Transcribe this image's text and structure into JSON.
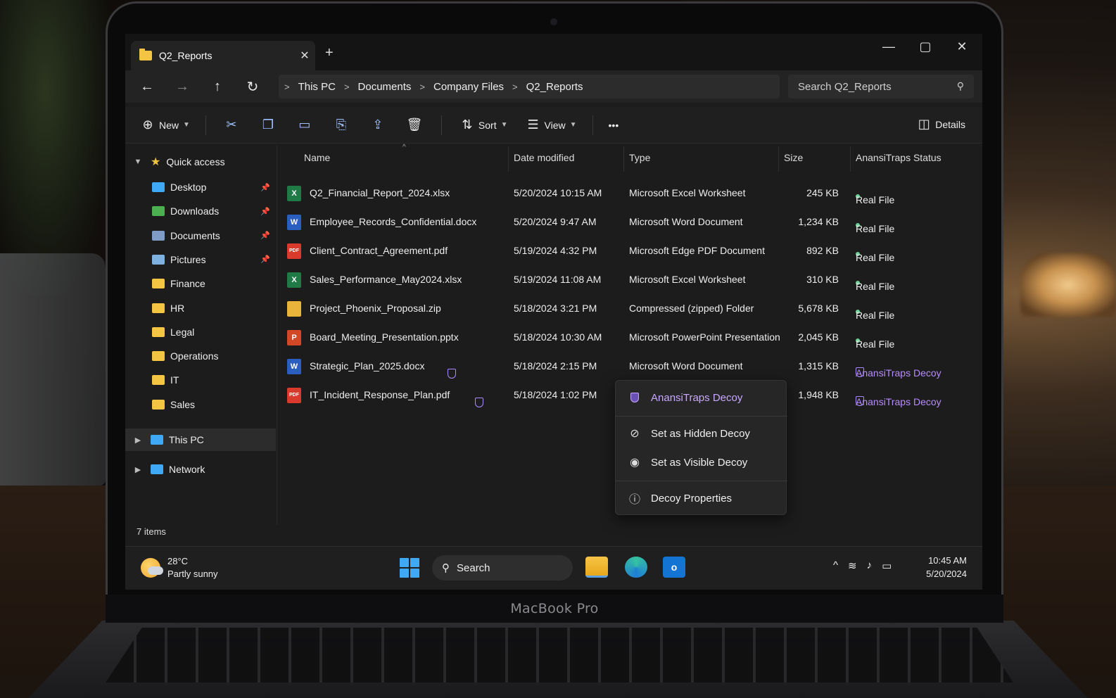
{
  "window": {
    "tab_title": "Q2_Reports",
    "tab_close": "✕",
    "new_tab": "+",
    "minimize": "—",
    "maximize": "▢",
    "close": "✕"
  },
  "nav": {
    "back": "←",
    "forward": "→",
    "up": "↑",
    "refresh": "↻",
    "breadcrumb": [
      "This PC",
      "Documents",
      "Company Files",
      "Q2_Reports"
    ],
    "search_placeholder": "Search Q2_Reports"
  },
  "toolbar": {
    "new_label": "New",
    "sort_label": "Sort",
    "view_label": "View",
    "more_label": "•••",
    "details_label": "Details"
  },
  "sidebar": {
    "quick_access": "Quick access",
    "items": [
      {
        "label": "Desktop",
        "pinned": true
      },
      {
        "label": "Downloads",
        "pinned": true
      },
      {
        "label": "Documents",
        "pinned": true
      },
      {
        "label": "Pictures",
        "pinned": true
      },
      {
        "label": "Finance",
        "pinned": false
      },
      {
        "label": "HR",
        "pinned": false
      },
      {
        "label": "Legal",
        "pinned": false
      },
      {
        "label": "Operations",
        "pinned": false
      },
      {
        "label": "IT",
        "pinned": false
      },
      {
        "label": "Sales",
        "pinned": false
      }
    ],
    "this_pc": "This PC",
    "network": "Network"
  },
  "columns": {
    "name": "Name",
    "date": "Date modified",
    "type": "Type",
    "size": "Size",
    "status": "AnansiTraps Status"
  },
  "files": [
    {
      "name": "Q2_Financial_Report_2024.xlsx",
      "date": "5/20/2024 10:15 AM",
      "type": "Microsoft Excel Worksheet",
      "size": "245 KB",
      "status": "Real File",
      "icon": "excel-icon",
      "decoy": false
    },
    {
      "name": "Employee_Records_Confidential.docx",
      "date": "5/20/2024 9:47 AM",
      "type": "Microsoft Word Document",
      "size": "1,234 KB",
      "status": "Real File",
      "icon": "word-icon",
      "decoy": false
    },
    {
      "name": "Client_Contract_Agreement.pdf",
      "date": "5/19/2024 4:32 PM",
      "type": "Microsoft Edge PDF Document",
      "size": "892 KB",
      "status": "Real File",
      "icon": "pdf-icon",
      "decoy": false
    },
    {
      "name": "Sales_Performance_May2024.xlsx",
      "date": "5/19/2024 11:08 AM",
      "type": "Microsoft Excel Worksheet",
      "size": "310 KB",
      "status": "Real File",
      "icon": "excel-icon",
      "decoy": false
    },
    {
      "name": "Project_Phoenix_Proposal.zip",
      "date": "5/18/2024 3:21 PM",
      "type": "Compressed (zipped) Folder",
      "size": "5,678 KB",
      "status": "Real File",
      "icon": "zip-icon",
      "decoy": false
    },
    {
      "name": "Board_Meeting_Presentation.pptx",
      "date": "5/18/2024 10:30 AM",
      "type": "Microsoft PowerPoint Presentation",
      "size": "2,045 KB",
      "status": "Real File",
      "icon": "powerpoint-icon",
      "decoy": false
    },
    {
      "name": "Strategic_Plan_2025.docx",
      "date": "5/18/2024 2:15 PM",
      "type": "Microsoft Word Document",
      "size": "1,315 KB",
      "status": "AnansiTraps Decoy",
      "icon": "word-icon",
      "decoy": true
    },
    {
      "name": "IT_Incident_Response_Plan.pdf",
      "date": "5/18/2024 1:02 PM",
      "type": "",
      "size": "1,948 KB",
      "status": "AnansiTraps Decoy",
      "icon": "pdf-icon",
      "decoy": true
    }
  ],
  "context_menu": {
    "header": "AnansiTraps Decoy",
    "hidden": "Set as Hidden Decoy",
    "visible": "Set as Visible Decoy",
    "properties": "Decoy Properties"
  },
  "status_bar": {
    "items": "7 items"
  },
  "taskbar": {
    "temperature": "28°C",
    "weather": "Partly sunny",
    "search": "Search",
    "time": "10:45 AM",
    "date": "5/20/2024"
  },
  "device": {
    "brand": "MacBook Pro"
  },
  "colors": {
    "accent": "#3fa9f5",
    "decoy": "#b78bff",
    "real_file_dot": "#6fcf97",
    "folder": "#f4c542"
  }
}
